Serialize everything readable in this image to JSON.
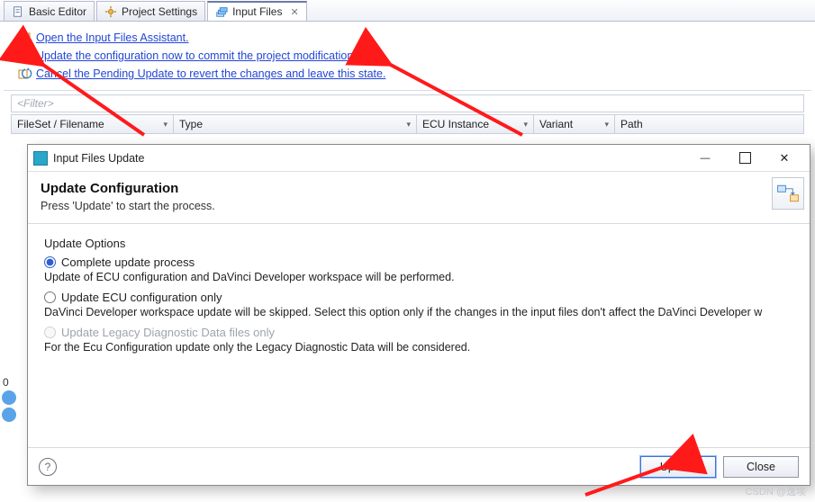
{
  "tabs": [
    {
      "label": "Basic Editor",
      "active": false
    },
    {
      "label": "Project Settings",
      "active": false
    },
    {
      "label": "Input Files",
      "active": true
    }
  ],
  "links": {
    "assistant": "Open the Input Files Assistant.",
    "update": "Update the configuration now to commit the project modifications.",
    "cancel": "Cancel the Pending Update to revert the changes and leave this state."
  },
  "filter_placeholder": "<Filter>",
  "columns": [
    "FileSet / Filename",
    "Type",
    "ECU Instance",
    "Variant",
    "Path"
  ],
  "dialog": {
    "window_title": "Input Files Update",
    "heading": "Update Configuration",
    "subheading": "Press 'Update' to start the process.",
    "group_title": "Update Options",
    "options": [
      {
        "label": "Complete update process",
        "selected": true,
        "enabled": true,
        "desc": "Update of ECU configuration and DaVinci Developer workspace will be performed."
      },
      {
        "label": "Update ECU configuration only",
        "selected": false,
        "enabled": true,
        "desc": "DaVinci Developer workspace update will be skipped. Select this option only if the changes in the input files don't affect the DaVinci Developer w"
      },
      {
        "label": "Update Legacy Diagnostic Data files only",
        "selected": false,
        "enabled": false,
        "desc": "For the Ecu Configuration update only the Legacy Diagnostic Data will be considered."
      }
    ],
    "buttons": {
      "ok": "Update",
      "cancel": "Close"
    }
  },
  "footer_zero": "0",
  "watermark": "CSDN @逸埃"
}
